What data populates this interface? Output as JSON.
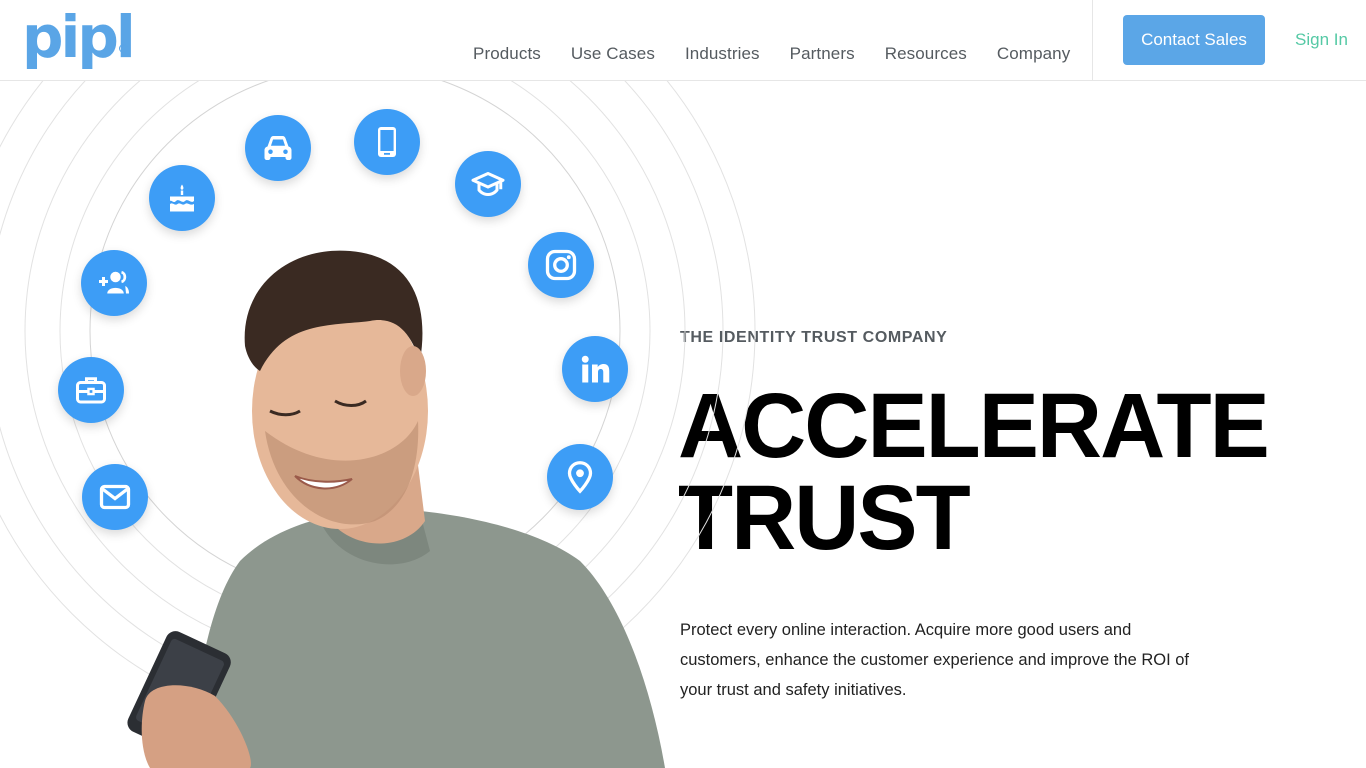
{
  "header": {
    "logo_text": "pipl",
    "logo_mark": "®",
    "nav": [
      "Products",
      "Use Cases",
      "Industries",
      "Partners",
      "Resources",
      "Company"
    ],
    "contact_label": "Contact Sales",
    "signin_label": "Sign In"
  },
  "hero": {
    "eyebrow": "THE IDENTITY TRUST COMPANY",
    "headline_line1": "ACCELERATE",
    "headline_line2": "TRUST",
    "body": "Protect every online interaction. Acquire more good users and customers, enhance the customer experience and improve the ROI of your trust and safety initiatives.",
    "ring_icons": [
      "mail-icon",
      "briefcase-icon",
      "add-user-group-icon",
      "birthday-cake-icon",
      "car-icon",
      "smartphone-icon",
      "graduation-cap-icon",
      "instagram-icon",
      "linkedin-icon",
      "location-pin-icon"
    ]
  },
  "colors": {
    "brand_blue": "#5aa5e6",
    "icon_blue": "#3d9df6",
    "button_blue": "#5ba6e7",
    "signin_green": "#55c9a5",
    "nav_text": "#555b60"
  }
}
